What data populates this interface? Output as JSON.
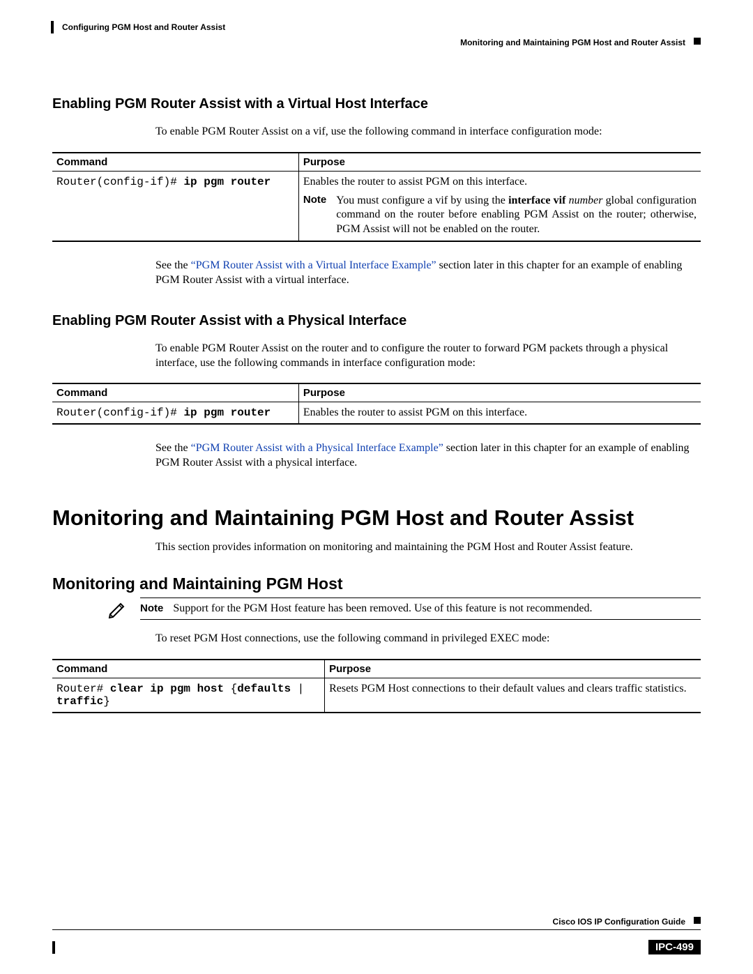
{
  "header": {
    "chapter_left": "Configuring PGM Host and Router Assist",
    "chapter_right": "Monitoring and Maintaining PGM Host and Router Assist"
  },
  "section1": {
    "title": "Enabling PGM Router Assist with a Virtual Host Interface",
    "intro": "To enable PGM Router Assist on a vif, use the following command in interface configuration mode:",
    "th_command": "Command",
    "th_purpose": "Purpose",
    "cmd_prefix": "Router(config-if)# ",
    "cmd_bold": "ip pgm router",
    "purpose_main": "Enables the router to assist PGM on this interface.",
    "note_label": "Note",
    "note_text_pre": "You must configure a vif by using the ",
    "note_cmd_bold": "interface vif",
    "note_cmd_ital": " number",
    "note_text_post": " global configuration command on the router before enabling PGM Assist on the router; otherwise, PGM Assist will not be enabled on the router.",
    "after_pre": "See the ",
    "after_link": "“PGM Router Assist with a Virtual Interface Example”",
    "after_post": " section later in this chapter for an example of enabling PGM Router Assist with a virtual interface."
  },
  "section2": {
    "title": "Enabling PGM Router Assist with a Physical Interface",
    "intro": "To enable PGM Router Assist on the router and to configure the router to forward PGM packets through a physical interface, use the following commands in interface configuration mode:",
    "th_command": "Command",
    "th_purpose": "Purpose",
    "cmd_prefix": "Router(config-if)# ",
    "cmd_bold": "ip pgm router",
    "purpose_main": "Enables the router to assist PGM on this interface.",
    "after_pre": "See the ",
    "after_link": "“PGM Router Assist with a Physical Interface Example”",
    "after_post": " section later in this chapter for an example of enabling PGM Router Assist with a physical interface."
  },
  "major": {
    "title": "Monitoring and Maintaining PGM Host and Router Assist",
    "intro": "This section provides information on monitoring and maintaining the PGM Host and Router Assist feature."
  },
  "section3": {
    "title": "Monitoring and Maintaining PGM Host",
    "note_label": "Note",
    "note_text": "Support for the PGM Host feature has been removed. Use of this feature is not recommended.",
    "intro": "To reset PGM Host connections, use the following command in privileged EXEC mode:",
    "th_command": "Command",
    "th_purpose": "Purpose",
    "cmd_prefix": "Router# ",
    "cmd_b1": "clear ip pgm host",
    "cmd_mid": " {",
    "cmd_b2": "defaults",
    "cmd_mid2": " | ",
    "cmd_b3": "traffic",
    "cmd_end": "}",
    "purpose_main": "Resets PGM Host connections to their default values and clears traffic statistics."
  },
  "footer": {
    "guide": "Cisco IOS IP Configuration Guide",
    "page": "IPC-499"
  }
}
